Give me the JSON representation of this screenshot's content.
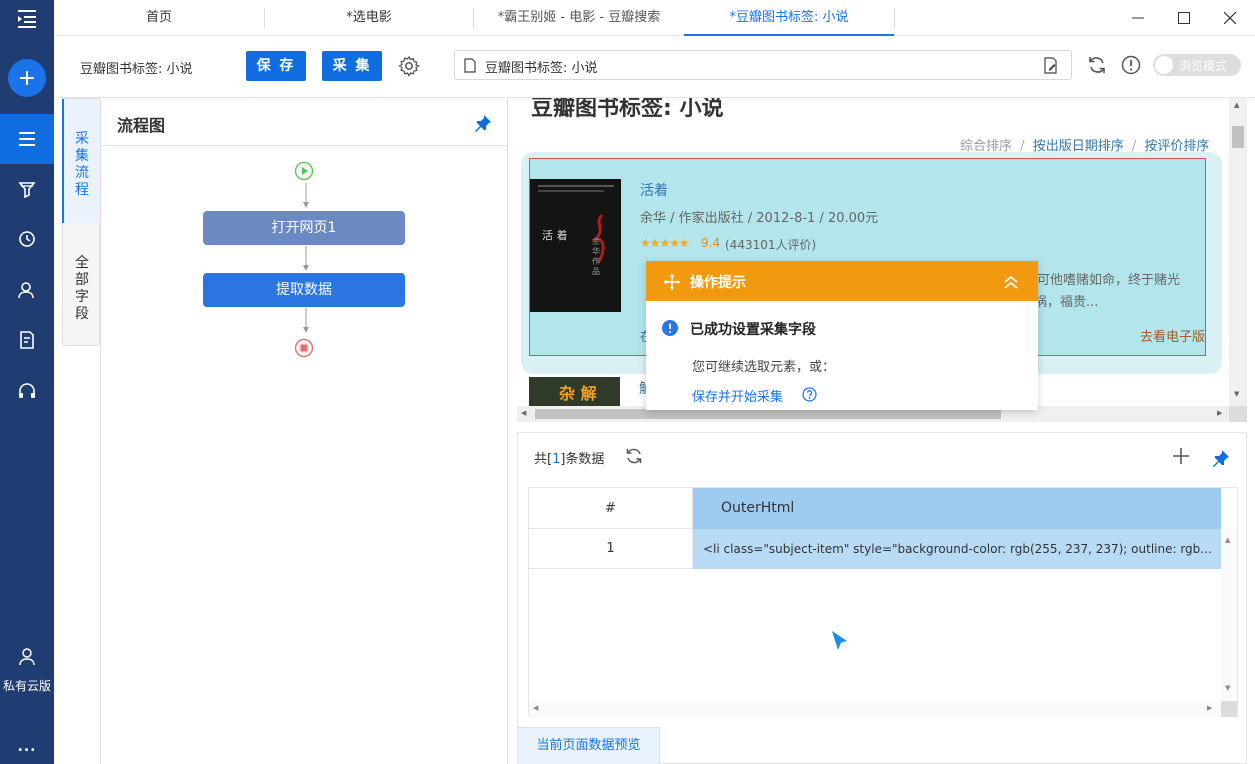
{
  "tabs": [
    {
      "label": "首页"
    },
    {
      "label": "*选电影"
    },
    {
      "label": "*霸王别姬 - 电影 - 豆瓣搜索"
    },
    {
      "label": "*豆瓣图书标签: 小说"
    }
  ],
  "sidebar": {
    "private_cloud": "私有云版",
    "more": "..."
  },
  "toolbar": {
    "task_name": "豆瓣图书标签: 小说",
    "save": "保 存",
    "collect": "采 集",
    "url": "豆瓣图书标签: 小说",
    "browse_mode": "浏览模式"
  },
  "sidetabs": {
    "flow": "采集流程",
    "fields": "全部字段"
  },
  "flow": {
    "title": "流程图",
    "node1": "打开网页1",
    "node2": "提取数据"
  },
  "page": {
    "heading": "豆瓣图书标签: 小说",
    "sort": {
      "overall": "综合排序",
      "date": "按出版日期排序",
      "rating": "按评价排序",
      "sep": "/"
    },
    "book": {
      "title": "活着",
      "pub": "余华 / 作家出版社 / 2012-8-1 / 20.00元",
      "rating": "9.4",
      "count": "(443101人评价)",
      "desc1": "，可他嗜赌如命，终于赌光",
      "desc2": "祸，福贵...",
      "ebook": "去看电子版",
      "cover_title": "活 着",
      "cover_author": "余华作品",
      "left_char": "在"
    },
    "next_char": "解"
  },
  "tip": {
    "header": "操作提示",
    "title": "已成功设置采集字段",
    "text": "您可继续选取元素，或：",
    "link": "保存并开始采集"
  },
  "data": {
    "count_prefix": "共[",
    "count": "1",
    "count_suffix": "]条数据",
    "col_index": "#",
    "col_html": "OuterHtml",
    "rows": [
      {
        "index": "1",
        "html": "<li class=\"subject-item\" style=\"background-color: rgb(255, 237, 237); outline: rgb..."
      }
    ],
    "preview_tab": "当前页面数据预览"
  },
  "colors": {
    "nav": "#1f3d72",
    "primary": "#0f6de0",
    "orange": "#f19a0f",
    "selection": "#b2e5ec"
  }
}
